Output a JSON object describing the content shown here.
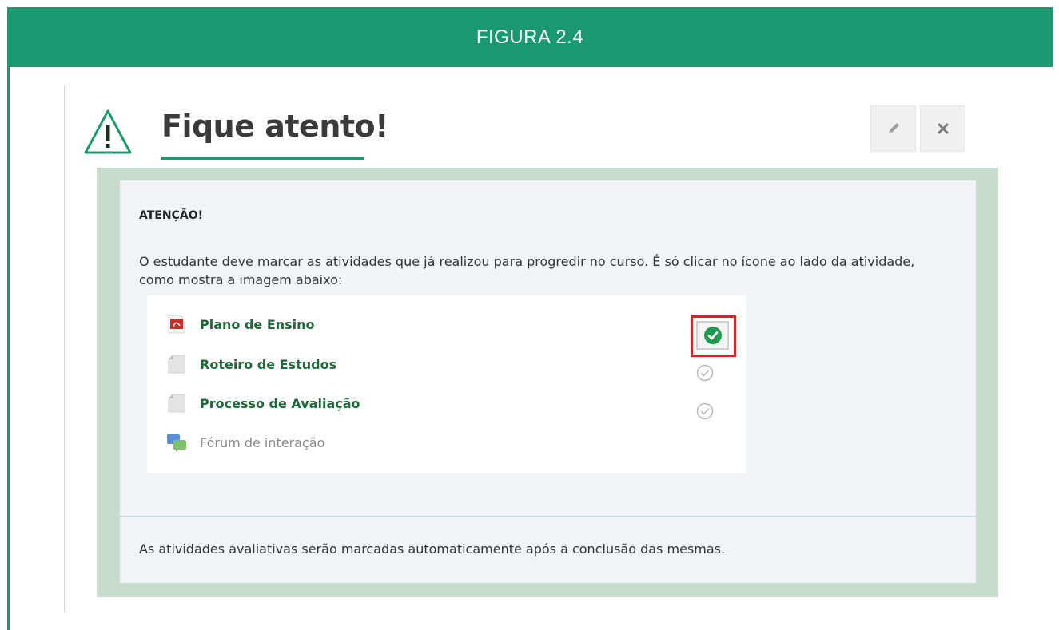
{
  "header": {
    "title": "FIGURA 2.4"
  },
  "notice": {
    "title": "Fique atento!",
    "heading": "ATENÇÃO!",
    "intro": "O estudante deve marcar as atividades que já realizou para progredir no curso. É só clicar no ícone ao lado da atividade, como mostra a imagem abaixo:",
    "footer": "As atividades avaliativas serão marcadas automaticamente após a conclusão das mesmas."
  },
  "activities": [
    {
      "label": "Plano de Ensino",
      "icon": "pdf-icon",
      "completed": true
    },
    {
      "label": "Roteiro de Estudos",
      "icon": "page-icon",
      "completed": false
    },
    {
      "label": "Processo de Avaliação",
      "icon": "page-icon",
      "completed": false
    },
    {
      "label": "Fórum de interação",
      "icon": "forum-icon",
      "completed": null
    }
  ],
  "toolbar": {
    "edit_icon": "pencil-icon",
    "close_icon": "close-icon"
  },
  "colors": {
    "accent": "#1a9970",
    "panel": "#c7dccd",
    "highlight": "#e02020",
    "link": "#1e6b3a",
    "check": "#1f9a4d"
  }
}
